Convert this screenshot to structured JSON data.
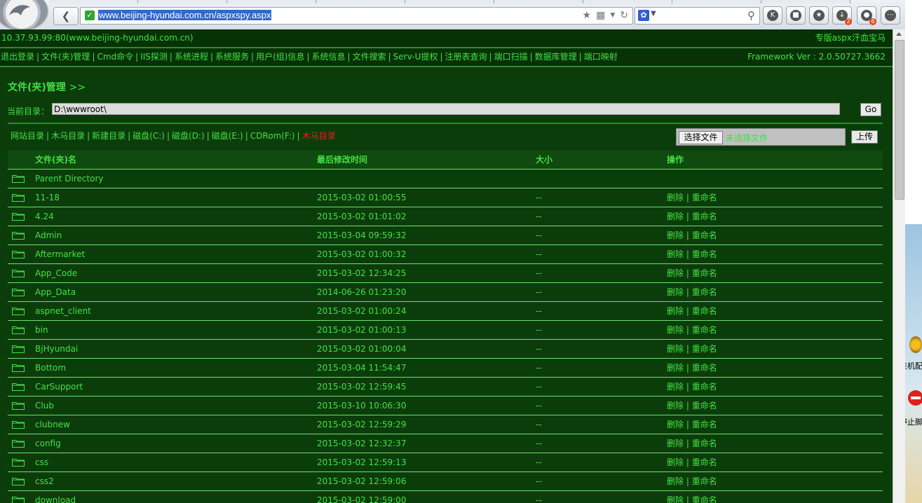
{
  "browser": {
    "url": "www.beijing-hyundai.com.cn/aspxspy.aspx",
    "badges": {
      "downloads": "2",
      "game": "6"
    }
  },
  "header": {
    "host": "10.37.93.99:80(www.beijing-hyundai.com.cn)",
    "brand": "专版aspx汗血宝马"
  },
  "nav": {
    "items": [
      "退出登录",
      "文件(夹)管理",
      "Cmd命令",
      "IIS探测",
      "系统进程",
      "系统服务",
      "用户(组)信息",
      "系统信息",
      "文件搜索",
      "Serv-U提权",
      "注册表查询",
      "端口扫描",
      "数据库管理",
      "端口映射"
    ],
    "framework": "Framework Ver : 2.0.50727.3662"
  },
  "main": {
    "title": "文件(夹)管理",
    "title_arrow": ">>",
    "curdir_label": "当前目录：",
    "curdir_value": "D:\\wwwroot\\",
    "go_label": "Go",
    "quick_links": [
      "网站目录",
      "木马目录",
      "新建目录",
      "磁盘(C:)",
      "磁盘(D:)",
      "磁盘(E:)",
      "CDRom(F:)"
    ],
    "quick_link_red": "木马目录",
    "choose_file_label": "选择文件",
    "no_file_label": "未选择文件",
    "upload_label": "上传"
  },
  "table": {
    "headers": {
      "name": "文件(夹)名",
      "time": "最后修改时间",
      "size": "大小",
      "ops": "操作"
    },
    "delete_label": "删除",
    "rename_label": "重命名",
    "ops_sep": "|",
    "rows": [
      {
        "name": "Parent Directory",
        "time": "",
        "size": "",
        "ops": false
      },
      {
        "name": "11-18",
        "time": "2015-03-02 01:00:55",
        "size": "--",
        "ops": true
      },
      {
        "name": "4.24",
        "time": "2015-03-02 01:01:02",
        "size": "--",
        "ops": true
      },
      {
        "name": "Admin",
        "time": "2015-03-04 09:59:32",
        "size": "--",
        "ops": true
      },
      {
        "name": "Aftermarket",
        "time": "2015-03-02 01:00:32",
        "size": "--",
        "ops": true
      },
      {
        "name": "App_Code",
        "time": "2015-03-02 12:34:25",
        "size": "--",
        "ops": true
      },
      {
        "name": "App_Data",
        "time": "2014-06-26 01:23:20",
        "size": "--",
        "ops": true
      },
      {
        "name": "aspnet_client",
        "time": "2015-03-02 01:00:24",
        "size": "--",
        "ops": true
      },
      {
        "name": "bin",
        "time": "2015-03-02 01:00:13",
        "size": "--",
        "ops": true
      },
      {
        "name": "BjHyundai",
        "time": "2015-03-02 01:00:04",
        "size": "--",
        "ops": true
      },
      {
        "name": "Bottom",
        "time": "2015-03-04 11:54:47",
        "size": "--",
        "ops": true
      },
      {
        "name": "CarSupport",
        "time": "2015-03-02 12:59:45",
        "size": "--",
        "ops": true
      },
      {
        "name": "Club",
        "time": "2015-03-10 10:06:30",
        "size": "--",
        "ops": true
      },
      {
        "name": "clubnew",
        "time": "2015-03-02 12:59:29",
        "size": "--",
        "ops": true
      },
      {
        "name": "config",
        "time": "2015-03-02 12:32:37",
        "size": "--",
        "ops": true
      },
      {
        "name": "css",
        "time": "2015-03-02 12:59:13",
        "size": "--",
        "ops": true
      },
      {
        "name": "css2",
        "time": "2015-03-02 12:59:06",
        "size": "--",
        "ops": true
      },
      {
        "name": "download",
        "time": "2015-03-02 12:59:00",
        "size": "--",
        "ops": true
      }
    ]
  },
  "desktop": {
    "label1": "挂机配",
    "label2": "停止脚"
  },
  "colors": {
    "text": "#44e044",
    "background": "#0b3d0b",
    "danger": "#e02020"
  }
}
